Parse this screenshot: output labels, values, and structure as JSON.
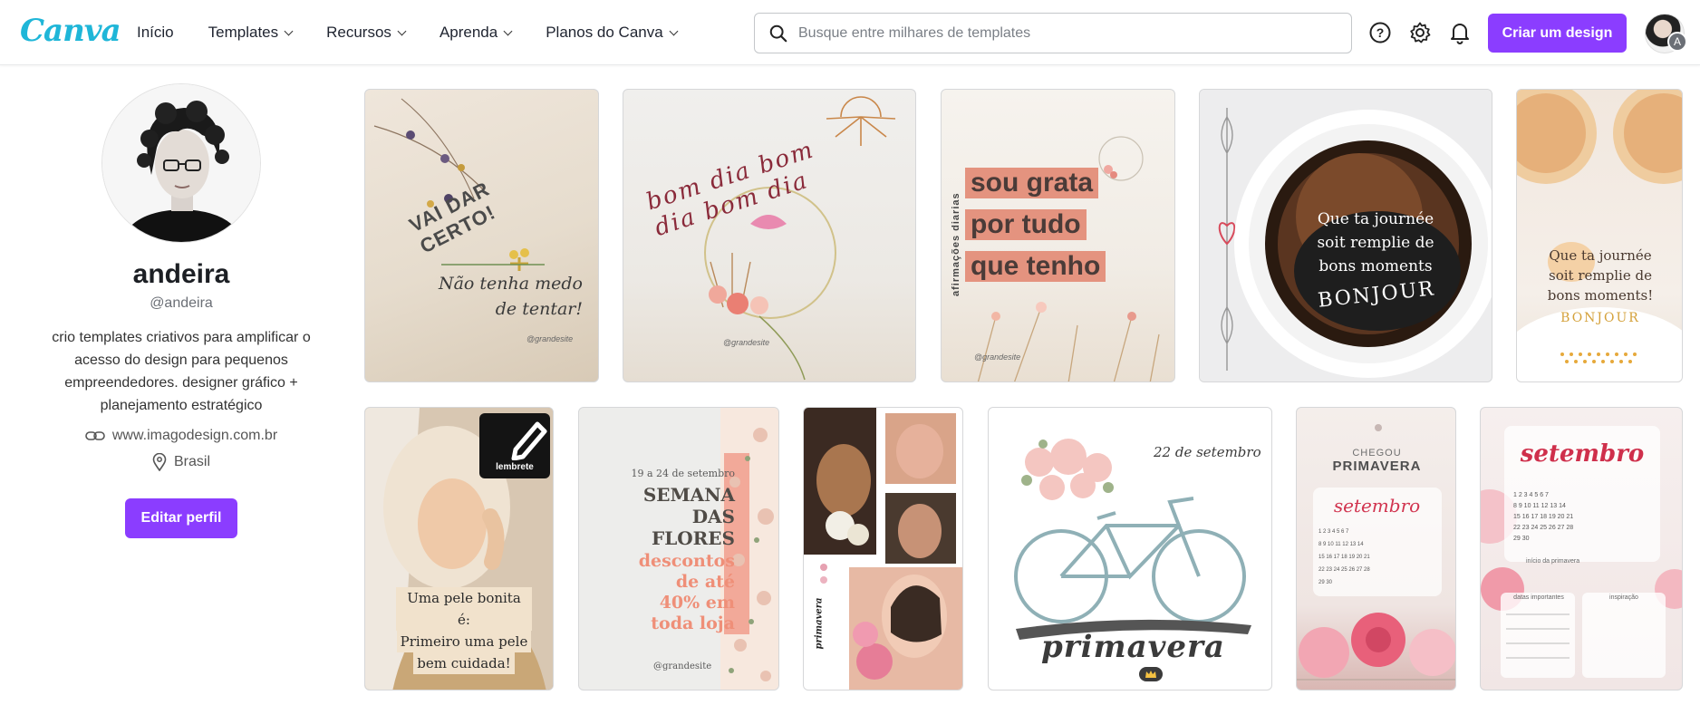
{
  "brand": {
    "logo": "Canva",
    "accent": "#8b3dff",
    "logo_color": "#1fb6d8"
  },
  "nav": {
    "items": [
      {
        "label": "Início"
      },
      {
        "label": "Templates"
      },
      {
        "label": "Recursos"
      },
      {
        "label": "Aprenda"
      },
      {
        "label": "Planos do Canva"
      }
    ]
  },
  "search": {
    "placeholder": "Busque entre milhares de templates",
    "value": ""
  },
  "toolbar": {
    "help_icon": "help-icon",
    "settings_icon": "gear-icon",
    "notifications_icon": "bell-icon",
    "create_label": "Criar um design",
    "avatar_badge": "A"
  },
  "profile": {
    "name": "andeira",
    "handle": "@andeira",
    "bio": "crio templates criativos para amplificar o acesso do design para pequenos empreendedores. designer gráfico + planejamento estratégico",
    "website": "www.imagodesign.com.br",
    "location": "Brasil",
    "edit_label": "Editar perfil"
  },
  "templates": [
    {
      "title": "VAI DAR CERTO!",
      "subtitle": "Não tenha medo de tentar!",
      "credit": "@grandesite"
    },
    {
      "title": "bom dia bom dia bom dia",
      "credit": "@grandesite"
    },
    {
      "side_label": "afirmações diarias",
      "lines": [
        "sou grata",
        "por tudo",
        "que tenho"
      ],
      "credit": "@grandesite"
    },
    {
      "lines": [
        "Que ta journée",
        "soit remplie de",
        "bons moments"
      ],
      "footer": "BONJOUR"
    },
    {
      "lines": [
        "Que ta journée",
        "soit remplie de",
        "bons moments!"
      ],
      "footer": "BONJOUR"
    },
    {
      "badge": "lembrete",
      "lines": [
        "Uma pele bonita é:",
        "Primeiro uma pele",
        "bem cuidada!"
      ]
    },
    {
      "date": "19 a 24 de setembro",
      "title_lines": [
        "SEMANA",
        "DAS",
        "FLORES"
      ],
      "offer_lines": [
        "descontos",
        "de até",
        "40% em",
        "toda loja"
      ],
      "credit": "@grandesite"
    },
    {
      "side_label": "primavera"
    },
    {
      "date": "22 de setembro",
      "title": "primavera",
      "pro_icon": "crown-icon"
    },
    {
      "kicker": "CHEGOU",
      "title": "PRIMAVERA",
      "month": "setembro"
    },
    {
      "month": "setembro",
      "note": "início da primavera",
      "box1": "datas importantes",
      "box2": "inspiração"
    }
  ]
}
